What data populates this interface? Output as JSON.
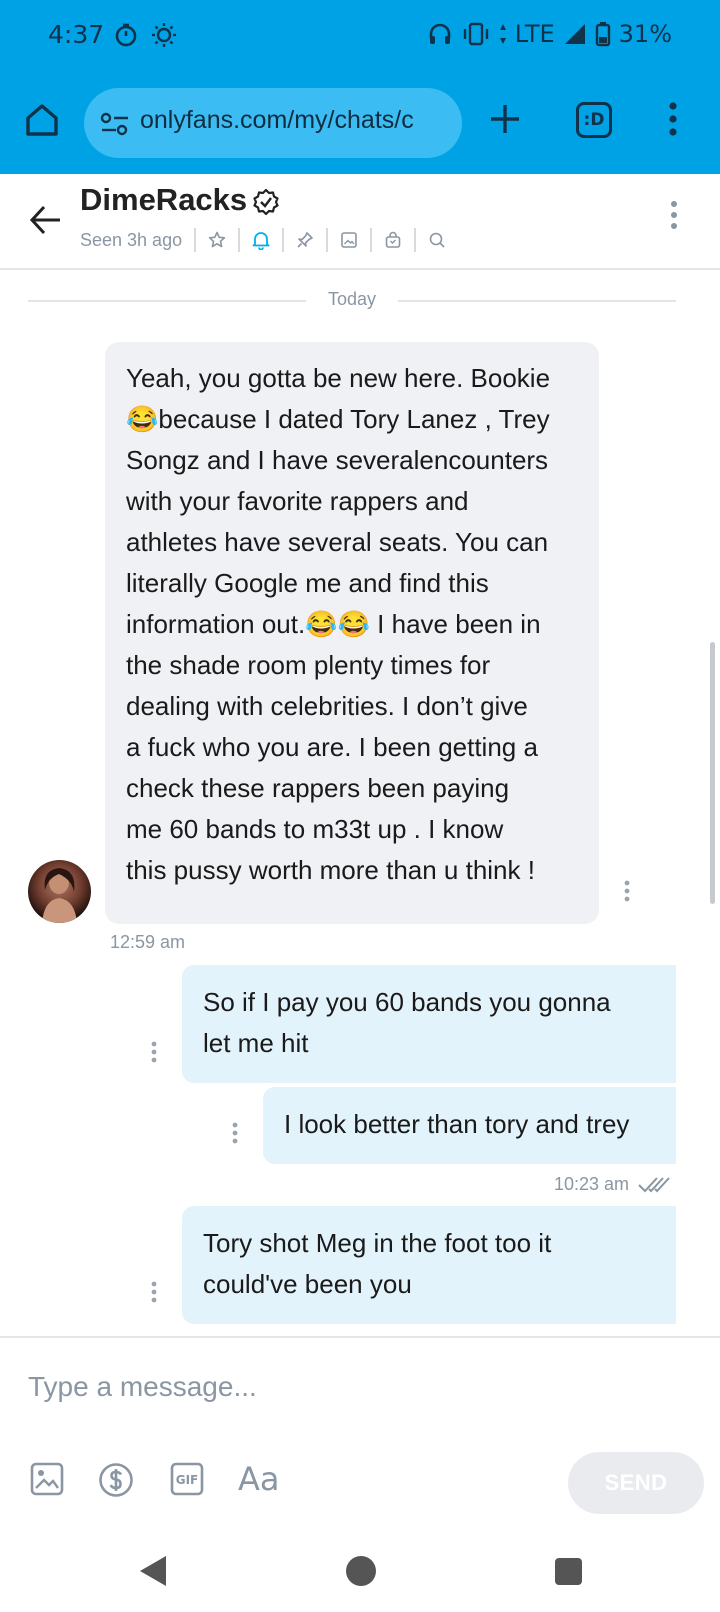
{
  "status_bar": {
    "time": "4:37",
    "network": "LTE",
    "battery": "31%",
    "icons": [
      "timer-icon",
      "brightness-icon",
      "headphones-icon",
      "vibrate-icon",
      "signal-icon",
      "battery-icon"
    ]
  },
  "browser": {
    "url": "onlyfans.com/my/chats/c",
    "tabs_label": ":D",
    "accent": "#00a2e6"
  },
  "chat": {
    "name": "DimeRacks",
    "seen": "Seen 3h ago",
    "day_separator": "Today",
    "header_icons": [
      "star-icon",
      "bell-icon",
      "pin-icon",
      "image-icon",
      "bag-icon",
      "search-icon"
    ]
  },
  "messages": [
    {
      "direction": "in",
      "lines": [
        "Yeah, you gotta be new here. Bookie",
        "😂because I dated Tory Lanez , Trey",
        "Songz and I have severalencounters",
        "with your favorite rappers and",
        "athletes have several seats. You can",
        "literally Google me and find this",
        "information out.😂😂 I have been in",
        "the shade room plenty times for",
        "dealing with celebrities. I don’t give",
        "a fuck who you are. I been getting a",
        "check these rappers been paying",
        "me 60 bands to m33t up . I know",
        "this pussy worth more than u think !"
      ],
      "time": "12:59 am"
    },
    {
      "direction": "out",
      "lines": [
        "So if I pay you 60 bands you gonna",
        "let me hit"
      ]
    },
    {
      "direction": "out",
      "lines": [
        "I look better than tory and trey"
      ],
      "time": "10:23 am"
    },
    {
      "direction": "out",
      "lines": [
        "Tory shot Meg in the foot too it",
        "could've been you"
      ]
    }
  ],
  "composer": {
    "placeholder": "Type a message...",
    "text_tool": "Aa",
    "send_label": "SEND",
    "tools": [
      "image-icon",
      "dollar-icon",
      "gif-icon",
      "text-format-icon"
    ]
  }
}
